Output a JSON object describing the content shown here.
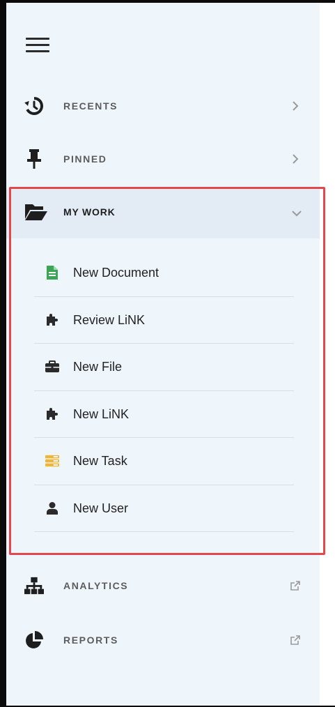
{
  "sidebar": {
    "menu_icon": "hamburger-menu-icon",
    "items": [
      {
        "id": "recents",
        "label": "RECENTS",
        "icon": "history-icon",
        "trailing": "chevron-right-icon"
      },
      {
        "id": "pinned",
        "label": "PINNED",
        "icon": "pushpin-icon",
        "trailing": "chevron-right-icon"
      },
      {
        "id": "mywork",
        "label": "MY WORK",
        "icon": "folder-open-icon",
        "trailing": "chevron-down-icon",
        "expanded": true
      },
      {
        "id": "analytics",
        "label": "ANALYTICS",
        "icon": "sitemap-icon",
        "trailing": "external-link-icon"
      },
      {
        "id": "reports",
        "label": "REPORTS",
        "icon": "pie-chart-icon",
        "trailing": "external-link-icon"
      }
    ],
    "mywork_children": [
      {
        "label": "New Document",
        "icon": "document-icon"
      },
      {
        "label": "Review LiNK",
        "icon": "puzzle-piece-icon"
      },
      {
        "label": "New File",
        "icon": "briefcase-icon"
      },
      {
        "label": "New LiNK",
        "icon": "puzzle-piece-icon"
      },
      {
        "label": "New Task",
        "icon": "tasks-icon"
      },
      {
        "label": "New User",
        "icon": "user-icon"
      }
    ]
  },
  "colors": {
    "sidebar_bg": "#eef6fc",
    "expanded_header_bg": "#e3ecf4",
    "highlight_outline": "#e5474d",
    "document_icon": "#3aa655",
    "task_icon": "#f0b535",
    "icon_dark": "#2b2b2b"
  }
}
